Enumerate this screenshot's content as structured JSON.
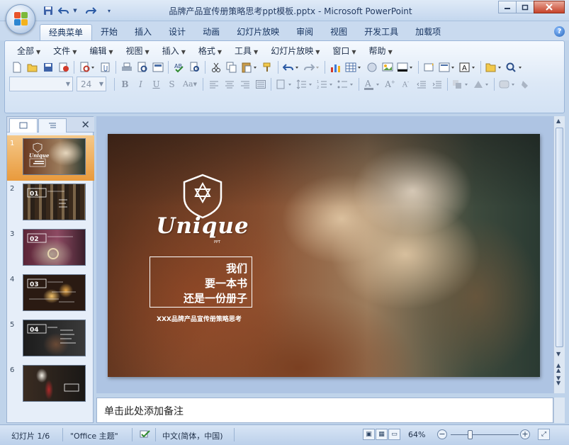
{
  "window": {
    "title": "品牌产品宣传册策略思考ppt模板.pptx - Microsoft PowerPoint",
    "minimize_icon": "minimize-icon",
    "maximize_icon": "maximize-icon",
    "close_icon": "close-icon"
  },
  "qat": {
    "save_icon": "save-icon",
    "undo_icon": "undo-icon",
    "redo_icon": "redo-icon",
    "customize_icon": "customize-qat-icon"
  },
  "ribbon_tabs": [
    "经典菜单",
    "开始",
    "插入",
    "设计",
    "动画",
    "幻灯片放映",
    "审阅",
    "视图",
    "开发工具",
    "加载项"
  ],
  "active_tab_index": 0,
  "menubar": [
    "全部",
    "文件",
    "编辑",
    "视图",
    "插入",
    "格式",
    "工具",
    "幻灯片放映",
    "窗口",
    "帮助"
  ],
  "font": {
    "name": "",
    "size": "24"
  },
  "panel": {
    "tab_slides_icon": "slides-tab-icon",
    "tab_outline_icon": "outline-tab-icon",
    "close_icon": "close-panel-icon",
    "thumbnails": [
      {
        "num": "1",
        "selected": true
      },
      {
        "num": "2",
        "selected": false
      },
      {
        "num": "3",
        "selected": false
      },
      {
        "num": "4",
        "selected": false
      },
      {
        "num": "5",
        "selected": false
      },
      {
        "num": "6",
        "selected": false
      }
    ],
    "thumb_labels": [
      "01",
      "02",
      "03",
      "04"
    ]
  },
  "slide": {
    "logo": "Unique",
    "logo_sub": "PPT",
    "tagline": [
      "我们",
      "要一本书",
      "还是一份册子"
    ],
    "subtitle": "XXX品牌产品宣传册策略思考"
  },
  "notes": {
    "placeholder": "单击此处添加备注"
  },
  "status": {
    "slide_info": "幻灯片 1/6",
    "theme": "\"Office 主题\"",
    "language": "中文(简体，中国)",
    "zoom": "64%"
  },
  "colors": {
    "ribbon": "#dce8f6",
    "selected_thumb": "#e99a3c",
    "accent": "#2463b9"
  }
}
